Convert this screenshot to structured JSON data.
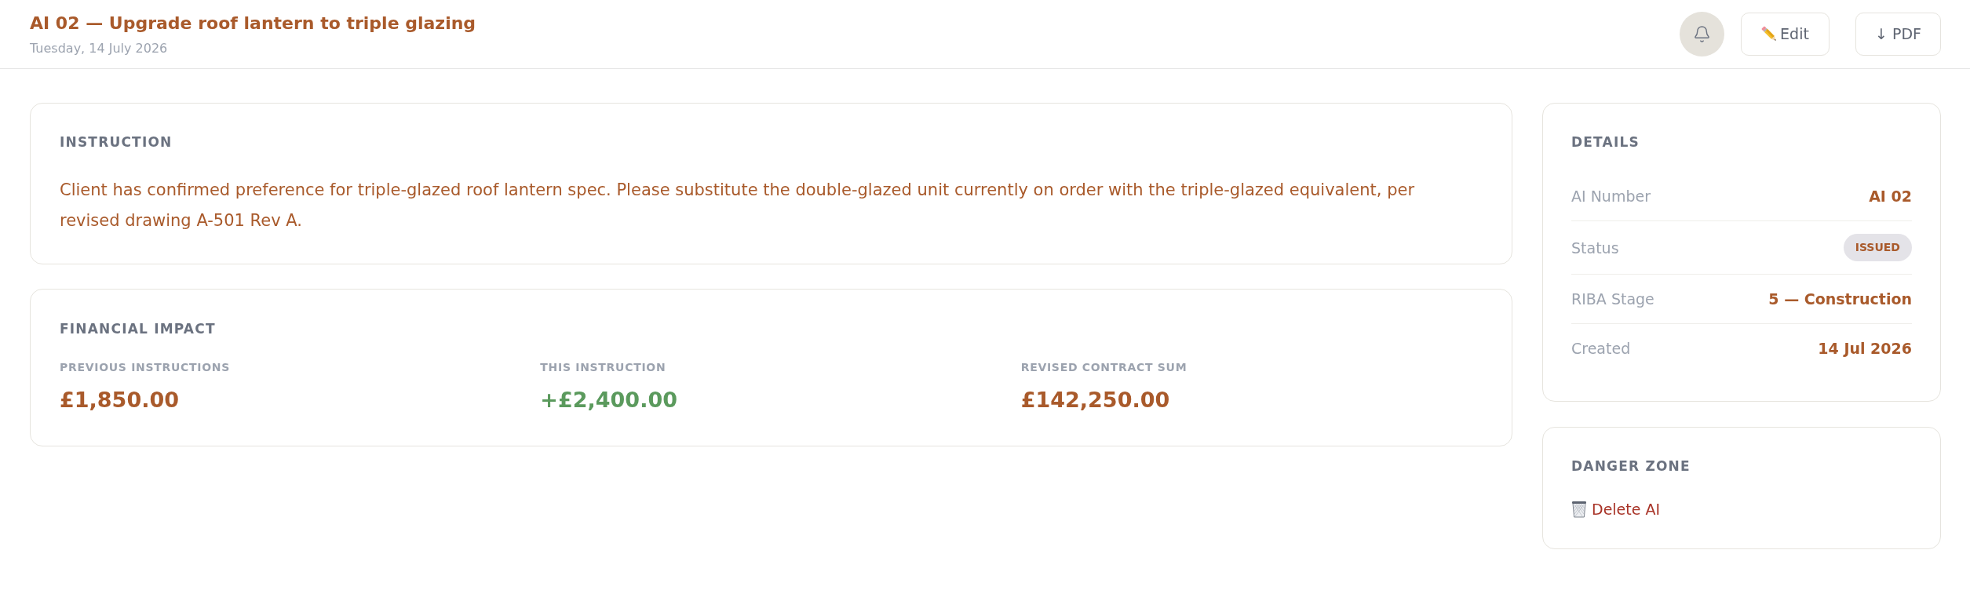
{
  "header": {
    "title": "AI 02 — Upgrade roof lantern to triple glazing",
    "date": "Tuesday, 14 July 2026",
    "actions": [
      {
        "kind": "notifications"
      },
      {
        "kind": "edit",
        "label": "Edit"
      },
      {
        "kind": "download",
        "label": "↓ PDF"
      }
    ]
  },
  "instruction": {
    "heading": "INSTRUCTION",
    "text": "Client has confirmed preference for triple-glazed roof lantern spec. Please substitute the double-glazed unit currently on order with the triple-glazed equivalent, per revised drawing A-501 Rev A."
  },
  "financial_impact": {
    "heading": "FINANCIAL IMPACT",
    "figures": [
      {
        "label": "PREVIOUS INSTRUCTIONS",
        "value": "£1,850.00",
        "color": "#a95a2b"
      },
      {
        "label": "THIS INSTRUCTION",
        "value": "+£2,400.00",
        "color": "#5b9a5d"
      },
      {
        "label": "REVISED CONTRACT SUM",
        "value": "£142,250.00",
        "color": "#a95a2b"
      }
    ]
  },
  "details": {
    "heading": "DETAILS",
    "rows": [
      {
        "kind": "text",
        "label": "AI Number",
        "value": "AI 02"
      },
      {
        "kind": "badge",
        "label": "Status",
        "value": "ISSUED"
      },
      {
        "kind": "text",
        "label": "RIBA Stage",
        "value": "5 — Construction"
      },
      {
        "kind": "text",
        "label": "Created",
        "value": "14 Jul 2026"
      }
    ]
  },
  "danger_zone": {
    "heading": "DANGER ZONE",
    "action": {
      "label": "Delete AI"
    }
  }
}
